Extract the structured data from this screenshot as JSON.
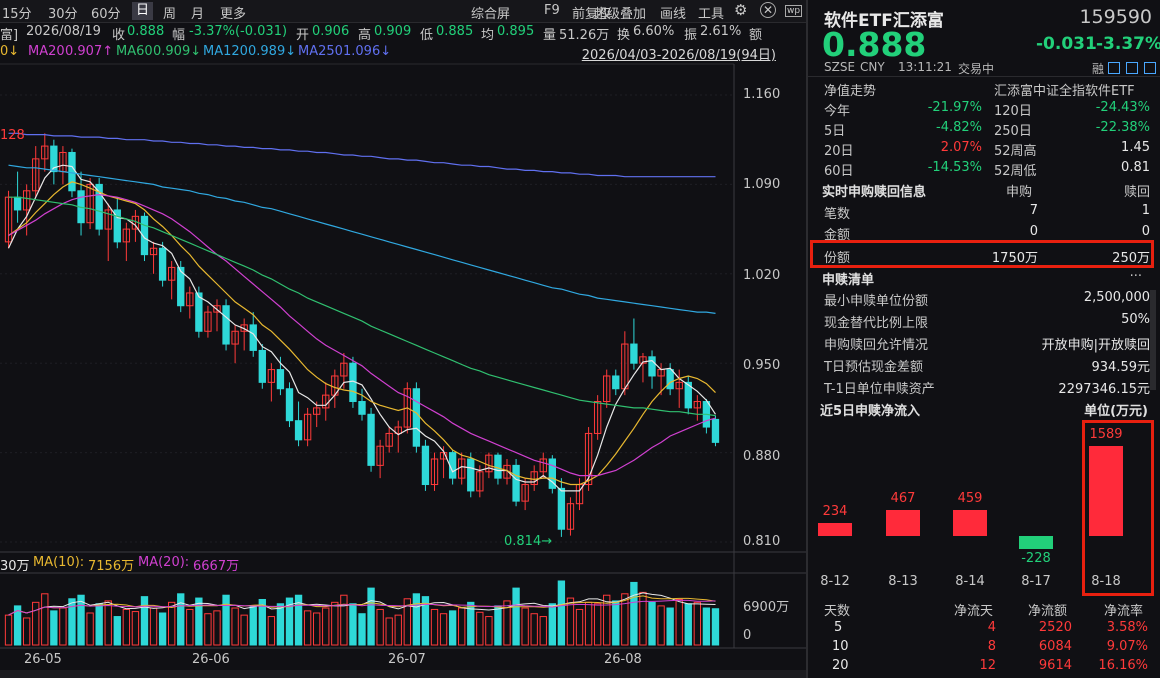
{
  "toolbar": {
    "periods": [
      "15分",
      "30分",
      "60分",
      "日",
      "周",
      "月",
      "更多"
    ],
    "active_period": "日",
    "tools": [
      "综合屏",
      "F9",
      "前复权",
      "超级叠加",
      "画线",
      "工具"
    ],
    "gear_icon": "gear-icon",
    "close_icon": "close-icon"
  },
  "info_line": {
    "left_fragment": "富]",
    "date": "2026/08/19",
    "close_label": "收",
    "close_val": "0.888",
    "range_label": "幅",
    "range_val": "-3.37%(-0.031)",
    "open_label": "开",
    "open_val": "0.906",
    "high_label": "高",
    "high_val": "0.909",
    "low_label": "低",
    "low_val": "0.885",
    "avg_label": "均",
    "avg_val": "0.895",
    "vol_label": "量",
    "vol_val": "51.26万",
    "turn_label": "换",
    "turn_val": "6.60%",
    "amp_label": "振",
    "amp_val": "2.61%",
    "amt_label": "额"
  },
  "ma_line": {
    "prefix": "0↓",
    "ma20_label": "MA20",
    "ma20_val": "0.907↑",
    "ma60_label": "MA60",
    "ma60_val": "0.909↓",
    "ma120_label": "MA120",
    "ma120_val": "0.989↓",
    "ma250_label": "MA250",
    "ma250_val": "1.096↓",
    "date_range": "2026/04/03-2026/08/19(94日)"
  },
  "colors": {
    "up": "#ff3a3a",
    "down": "#2ed8d8",
    "ma5": "#e8e8e8",
    "ma10": "#e8b830",
    "ma20": "#d040d0",
    "ma60": "#30c070",
    "ma120": "#30a8e0",
    "ma250": "#6070f0"
  },
  "price_axis": {
    "ticks": [
      "1.160",
      "1.090",
      "1.020",
      "0.950",
      "0.880",
      "0.810"
    ]
  },
  "annotations": {
    "high_mark": "128",
    "low_mark": "0.814"
  },
  "volume_info": {
    "prefix": "30万",
    "ma10_label": "MA(10):",
    "ma10_val": "7156万",
    "ma20_label": "MA(20):",
    "ma20_val": "6667万",
    "axis_top": "6900万",
    "axis_zero": "0"
  },
  "x_axis": {
    "labels": [
      "26-05",
      "26-06",
      "26-07",
      "26-08"
    ]
  },
  "chart_data": {
    "type": "candlestick",
    "title": "",
    "ylim": [
      0.8,
      1.17
    ],
    "candles": [
      [
        1.045,
        1.085,
        1.04,
        1.08
      ],
      [
        1.08,
        1.1,
        1.06,
        1.07
      ],
      [
        1.07,
        1.09,
        1.05,
        1.085
      ],
      [
        1.085,
        1.12,
        1.08,
        1.11
      ],
      [
        1.11,
        1.13,
        1.1,
        1.12
      ],
      [
        1.12,
        1.125,
        1.09,
        1.1
      ],
      [
        1.1,
        1.12,
        1.09,
        1.115
      ],
      [
        1.115,
        1.118,
        1.08,
        1.085
      ],
      [
        1.085,
        1.1,
        1.05,
        1.06
      ],
      [
        1.06,
        1.095,
        1.055,
        1.09
      ],
      [
        1.09,
        1.095,
        1.05,
        1.055
      ],
      [
        1.055,
        1.075,
        1.03,
        1.07
      ],
      [
        1.07,
        1.08,
        1.04,
        1.045
      ],
      [
        1.045,
        1.06,
        1.03,
        1.055
      ],
      [
        1.055,
        1.07,
        1.045,
        1.065
      ],
      [
        1.065,
        1.068,
        1.03,
        1.035
      ],
      [
        1.035,
        1.045,
        1.02,
        1.04
      ],
      [
        1.04,
        1.045,
        1.01,
        1.015
      ],
      [
        1.015,
        1.03,
        1.0,
        1.025
      ],
      [
        1.025,
        1.03,
        0.99,
        0.995
      ],
      [
        0.995,
        1.01,
        0.985,
        1.005
      ],
      [
        1.005,
        1.01,
        0.97,
        0.975
      ],
      [
        0.975,
        0.995,
        0.97,
        0.99
      ],
      [
        0.99,
        1.0,
        0.975,
        0.995
      ],
      [
        0.995,
        1.0,
        0.96,
        0.965
      ],
      [
        0.965,
        0.98,
        0.95,
        0.975
      ],
      [
        0.975,
        0.985,
        0.96,
        0.98
      ],
      [
        0.98,
        0.99,
        0.955,
        0.96
      ],
      [
        0.96,
        0.965,
        0.93,
        0.935
      ],
      [
        0.935,
        0.95,
        0.92,
        0.945
      ],
      [
        0.945,
        0.955,
        0.925,
        0.93
      ],
      [
        0.93,
        0.935,
        0.9,
        0.905
      ],
      [
        0.905,
        0.92,
        0.885,
        0.89
      ],
      [
        0.89,
        0.915,
        0.885,
        0.91
      ],
      [
        0.91,
        0.92,
        0.9,
        0.915
      ],
      [
        0.915,
        0.935,
        0.905,
        0.925
      ],
      [
        0.925,
        0.945,
        0.915,
        0.94
      ],
      [
        0.94,
        0.958,
        0.93,
        0.95
      ],
      [
        0.95,
        0.955,
        0.915,
        0.92
      ],
      [
        0.92,
        0.93,
        0.905,
        0.91
      ],
      [
        0.91,
        0.915,
        0.865,
        0.87
      ],
      [
        0.87,
        0.89,
        0.86,
        0.885
      ],
      [
        0.885,
        0.9,
        0.88,
        0.895
      ],
      [
        0.895,
        0.905,
        0.88,
        0.9
      ],
      [
        0.9,
        0.935,
        0.895,
        0.93
      ],
      [
        0.93,
        0.935,
        0.88,
        0.885
      ],
      [
        0.885,
        0.89,
        0.85,
        0.855
      ],
      [
        0.855,
        0.88,
        0.85,
        0.875
      ],
      [
        0.875,
        0.885,
        0.86,
        0.88
      ],
      [
        0.88,
        0.882,
        0.855,
        0.86
      ],
      [
        0.86,
        0.88,
        0.855,
        0.875
      ],
      [
        0.875,
        0.88,
        0.845,
        0.85
      ],
      [
        0.85,
        0.87,
        0.845,
        0.865
      ],
      [
        0.865,
        0.88,
        0.86,
        0.878
      ],
      [
        0.878,
        0.88,
        0.855,
        0.86
      ],
      [
        0.86,
        0.875,
        0.855,
        0.87
      ],
      [
        0.87,
        0.875,
        0.838,
        0.842
      ],
      [
        0.842,
        0.86,
        0.835,
        0.855
      ],
      [
        0.855,
        0.87,
        0.85,
        0.865
      ],
      [
        0.865,
        0.88,
        0.86,
        0.875
      ],
      [
        0.875,
        0.878,
        0.848,
        0.852
      ],
      [
        0.852,
        0.86,
        0.814,
        0.82
      ],
      [
        0.82,
        0.845,
        0.815,
        0.84
      ],
      [
        0.84,
        0.86,
        0.835,
        0.855
      ],
      [
        0.855,
        0.9,
        0.85,
        0.895
      ],
      [
        0.895,
        0.925,
        0.89,
        0.92
      ],
      [
        0.92,
        0.945,
        0.915,
        0.94
      ],
      [
        0.94,
        0.945,
        0.925,
        0.93
      ],
      [
        0.93,
        0.975,
        0.925,
        0.965
      ],
      [
        0.965,
        0.985,
        0.945,
        0.95
      ],
      [
        0.95,
        0.958,
        0.935,
        0.955
      ],
      [
        0.955,
        0.96,
        0.93,
        0.94
      ],
      [
        0.94,
        0.95,
        0.925,
        0.945
      ],
      [
        0.945,
        0.95,
        0.925,
        0.93
      ],
      [
        0.93,
        0.945,
        0.915,
        0.935
      ],
      [
        0.935,
        0.94,
        0.91,
        0.915
      ],
      [
        0.915,
        0.925,
        0.905,
        0.92
      ],
      [
        0.92,
        0.922,
        0.895,
        0.9
      ],
      [
        0.906,
        0.909,
        0.885,
        0.888
      ]
    ],
    "ma": [
      {
        "name": "MA5",
        "values": [
          1.04,
          1.055,
          1.065,
          1.08,
          1.095,
          1.103,
          1.105,
          1.104,
          1.094,
          1.092,
          1.084,
          1.074,
          1.064,
          1.063,
          1.058,
          1.048,
          1.044,
          1.042,
          1.036,
          1.022,
          1.016,
          1.002,
          0.998,
          0.992,
          0.986,
          0.98,
          0.977,
          0.973,
          0.963,
          0.959,
          0.95,
          0.943,
          0.927,
          0.923,
          0.917,
          0.917,
          0.925,
          0.935,
          0.936,
          0.933,
          0.922,
          0.91,
          0.9,
          0.894,
          0.898,
          0.899,
          0.893,
          0.889,
          0.881,
          0.865,
          0.869,
          0.868,
          0.866,
          0.868,
          0.866,
          0.866,
          0.859,
          0.857,
          0.857,
          0.862,
          0.857,
          0.85,
          0.85,
          0.85,
          0.86,
          0.878,
          0.9,
          0.918,
          0.93,
          0.941,
          0.951,
          0.952,
          0.945,
          0.946,
          0.938,
          0.933,
          0.928,
          0.921,
          0.91
        ]
      },
      {
        "name": "MA10",
        "values": [
          1.05,
          1.055,
          1.06,
          1.068,
          1.075,
          1.082,
          1.088,
          1.092,
          1.09,
          1.087,
          1.084,
          1.081,
          1.079,
          1.077,
          1.075,
          1.07,
          1.063,
          1.057,
          1.05,
          1.042,
          1.035,
          1.026,
          1.019,
          1.012,
          1.005,
          0.998,
          0.993,
          0.988,
          0.98,
          0.975,
          0.968,
          0.961,
          0.953,
          0.945,
          0.939,
          0.934,
          0.931,
          0.929,
          0.928,
          0.925,
          0.92,
          0.917,
          0.915,
          0.913,
          0.915,
          0.911,
          0.903,
          0.897,
          0.89,
          0.882,
          0.878,
          0.876,
          0.873,
          0.87,
          0.868,
          0.866,
          0.862,
          0.86,
          0.859,
          0.86,
          0.86,
          0.857,
          0.855,
          0.855,
          0.858,
          0.862,
          0.87,
          0.879,
          0.889,
          0.899,
          0.91,
          0.92,
          0.928,
          0.935,
          0.938,
          0.94,
          0.938,
          0.934,
          0.927
        ]
      },
      {
        "name": "MA20",
        "values": [
          1.05,
          1.054,
          1.058,
          1.062,
          1.067,
          1.071,
          1.075,
          1.078,
          1.08,
          1.081,
          1.082,
          1.081,
          1.08,
          1.078,
          1.076,
          1.073,
          1.07,
          1.067,
          1.063,
          1.058,
          1.053,
          1.047,
          1.041,
          1.035,
          1.03,
          1.024,
          1.018,
          1.012,
          1.006,
          1.0,
          0.994,
          0.987,
          0.981,
          0.975,
          0.969,
          0.964,
          0.96,
          0.956,
          0.952,
          0.948,
          0.942,
          0.937,
          0.932,
          0.927,
          0.924,
          0.92,
          0.916,
          0.912,
          0.908,
          0.903,
          0.899,
          0.895,
          0.892,
          0.889,
          0.886,
          0.883,
          0.88,
          0.877,
          0.874,
          0.872,
          0.87,
          0.867,
          0.864,
          0.862,
          0.862,
          0.862,
          0.864,
          0.866,
          0.87,
          0.874,
          0.879,
          0.884,
          0.888,
          0.893,
          0.896,
          0.899,
          0.902,
          0.905,
          0.907
        ]
      },
      {
        "name": "MA60",
        "values": [
          1.08,
          1.08,
          1.079,
          1.078,
          1.077,
          1.076,
          1.075,
          1.074,
          1.072,
          1.071,
          1.069,
          1.067,
          1.065,
          1.063,
          1.061,
          1.058,
          1.056,
          1.053,
          1.05,
          1.047,
          1.044,
          1.041,
          1.038,
          1.035,
          1.032,
          1.029,
          1.026,
          1.023,
          1.019,
          1.016,
          1.012,
          1.008,
          1.005,
          1.001,
          0.998,
          0.995,
          0.992,
          0.989,
          0.986,
          0.983,
          0.979,
          0.976,
          0.973,
          0.97,
          0.967,
          0.964,
          0.961,
          0.958,
          0.955,
          0.952,
          0.949,
          0.946,
          0.944,
          0.941,
          0.939,
          0.937,
          0.935,
          0.933,
          0.931,
          0.929,
          0.927,
          0.925,
          0.923,
          0.921,
          0.92,
          0.919,
          0.918,
          0.917,
          0.916,
          0.915,
          0.915,
          0.914,
          0.913,
          0.912,
          0.912,
          0.911,
          0.91,
          0.91,
          0.909
        ]
      },
      {
        "name": "MA120",
        "values": [
          1.105,
          1.104,
          1.103,
          1.103,
          1.102,
          1.101,
          1.1,
          1.099,
          1.098,
          1.097,
          1.096,
          1.095,
          1.094,
          1.093,
          1.092,
          1.091,
          1.09,
          1.088,
          1.087,
          1.086,
          1.085,
          1.083,
          1.082,
          1.08,
          1.079,
          1.077,
          1.076,
          1.074,
          1.072,
          1.071,
          1.069,
          1.067,
          1.065,
          1.063,
          1.061,
          1.059,
          1.057,
          1.055,
          1.053,
          1.051,
          1.049,
          1.047,
          1.045,
          1.043,
          1.041,
          1.039,
          1.037,
          1.035,
          1.033,
          1.031,
          1.029,
          1.027,
          1.025,
          1.023,
          1.021,
          1.019,
          1.017,
          1.015,
          1.013,
          1.011,
          1.009,
          1.008,
          1.006,
          1.004,
          1.003,
          1.001,
          1.0,
          0.999,
          0.998,
          0.997,
          0.996,
          0.995,
          0.994,
          0.993,
          0.992,
          0.991,
          0.99,
          0.99,
          0.989
        ]
      },
      {
        "name": "MA250",
        "values": [
          1.13,
          1.13,
          1.129,
          1.129,
          1.129,
          1.128,
          1.128,
          1.128,
          1.127,
          1.127,
          1.127,
          1.126,
          1.126,
          1.125,
          1.125,
          1.125,
          1.124,
          1.124,
          1.123,
          1.123,
          1.122,
          1.122,
          1.121,
          1.121,
          1.12,
          1.12,
          1.119,
          1.119,
          1.118,
          1.118,
          1.117,
          1.117,
          1.116,
          1.116,
          1.115,
          1.115,
          1.114,
          1.113,
          1.113,
          1.112,
          1.112,
          1.111,
          1.11,
          1.11,
          1.109,
          1.109,
          1.108,
          1.107,
          1.107,
          1.106,
          1.105,
          1.105,
          1.104,
          1.104,
          1.103,
          1.102,
          1.102,
          1.101,
          1.101,
          1.1,
          1.1,
          1.099,
          1.099,
          1.098,
          1.098,
          1.097,
          1.097,
          1.097,
          1.096,
          1.096,
          1.096,
          1.096,
          1.096,
          1.096,
          1.096,
          1.096,
          1.096,
          1.096,
          1.096
        ]
      }
    ],
    "volume": [
      42,
      55,
      38,
      60,
      72,
      48,
      52,
      65,
      70,
      45,
      58,
      62,
      40,
      50,
      47,
      68,
      52,
      45,
      60,
      72,
      50,
      66,
      44,
      48,
      70,
      52,
      42,
      55,
      64,
      40,
      58,
      66,
      70,
      48,
      45,
      52,
      60,
      70,
      58,
      44,
      80,
      50,
      38,
      42,
      65,
      72,
      68,
      50,
      44,
      48,
      52,
      60,
      46,
      40,
      55,
      62,
      80,
      52,
      44,
      40,
      58,
      90,
      66,
      50,
      60,
      58,
      70,
      62,
      72,
      88,
      74,
      60,
      55,
      52,
      64,
      58,
      60,
      52,
      51
    ]
  },
  "right": {
    "title": "软件ETF汇添富",
    "code": "159590",
    "price": "0.888",
    "change": "-0.031",
    "change_pct": "-3.37%",
    "market": "SZSE",
    "currency": "CNY",
    "time": "13:11:21",
    "status": "交易中",
    "margin_tag": "融",
    "nav_header": "净值走势",
    "nav_desc": "汇添富中证全指软件ETF",
    "perf": [
      {
        "l1": "今年",
        "v1": "-21.97%",
        "l2": "120日",
        "v2": "-24.43%"
      },
      {
        "l1": "5日",
        "v1": "-4.82%",
        "l2": "250日",
        "v2": "-22.38%"
      },
      {
        "l1": "20日",
        "v1": "2.07%",
        "l2": "52周高",
        "v2": "1.45"
      },
      {
        "l1": "60日",
        "v1": "-14.53%",
        "l2": "52周低",
        "v2": "0.81"
      }
    ],
    "realtime_header": "实时申购赎回信息",
    "rt_col_sub": "申购",
    "rt_col_red": "赎回",
    "rt_rows": [
      {
        "label": "笔数",
        "sub": "7",
        "red": "1"
      },
      {
        "label": "金额",
        "sub": "0",
        "red": "0"
      },
      {
        "label": "份额",
        "sub": "1750万",
        "red": "250万"
      }
    ],
    "list_header": "申赎清单",
    "list_more": "···",
    "list_rows": [
      {
        "label": "最小申赎单位份额",
        "val": "2,500,000"
      },
      {
        "label": "现金替代比例上限",
        "val": "50%"
      },
      {
        "label": "申购赎回允许情况",
        "val": "开放申购|开放赎回"
      },
      {
        "label": "T日预估现金差额",
        "val": "934.59元"
      },
      {
        "label": "T-1日单位申赎资产",
        "val": "2297346.15元"
      }
    ],
    "flow_header": "近5日申赎净流入",
    "flow_unit": "单位(万元)",
    "flow_chart": {
      "type": "bar",
      "categories": [
        "8-12",
        "8-13",
        "8-14",
        "8-17",
        "8-18"
      ],
      "values": [
        234,
        467,
        459,
        -228,
        1589
      ]
    },
    "stats_headers": [
      "天数",
      "净流天",
      "净流额",
      "净流率"
    ],
    "stats_rows": [
      [
        "5",
        "4",
        "2520",
        "3.58%"
      ],
      [
        "10",
        "8",
        "6084",
        "9.07%"
      ],
      [
        "20",
        "12",
        "9614",
        "16.16%"
      ]
    ]
  }
}
